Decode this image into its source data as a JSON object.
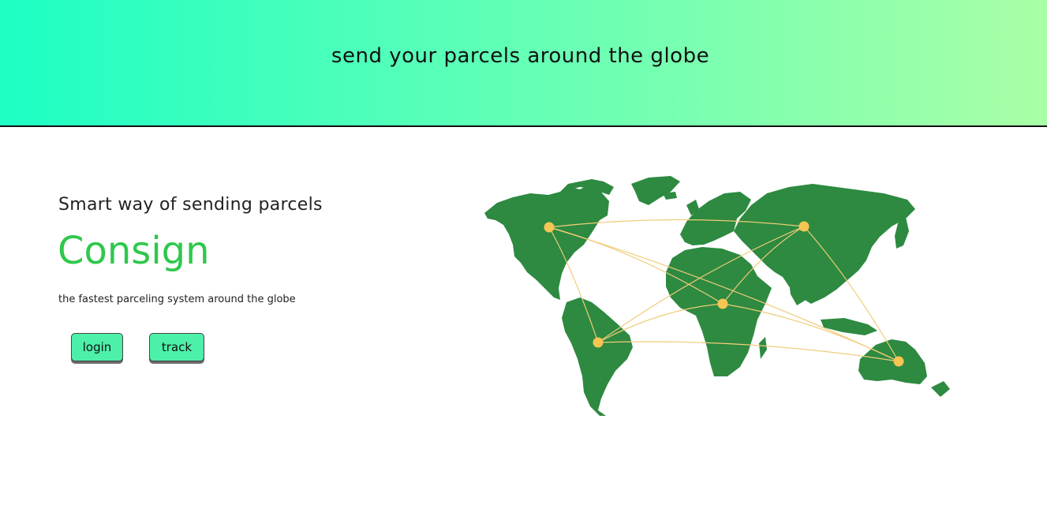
{
  "header": {
    "title": "send your parcels around the globe"
  },
  "hero": {
    "tagline": "Smart way of sending parcels",
    "brand": "Consign",
    "subtitle": "the fastest parceling system around the globe"
  },
  "buttons": {
    "login_label": "login",
    "track_label": "track"
  },
  "map": {
    "icon": "world-map-network",
    "node_count": 5
  },
  "colors": {
    "header_gradient_start": "#1dffc4",
    "header_gradient_end": "#a9ffa6",
    "brand": "#2ec84b",
    "button_bg": "#4cf0a8",
    "land": "#2d8a40",
    "node": "#f6c552",
    "route": "#f0cc7a"
  }
}
